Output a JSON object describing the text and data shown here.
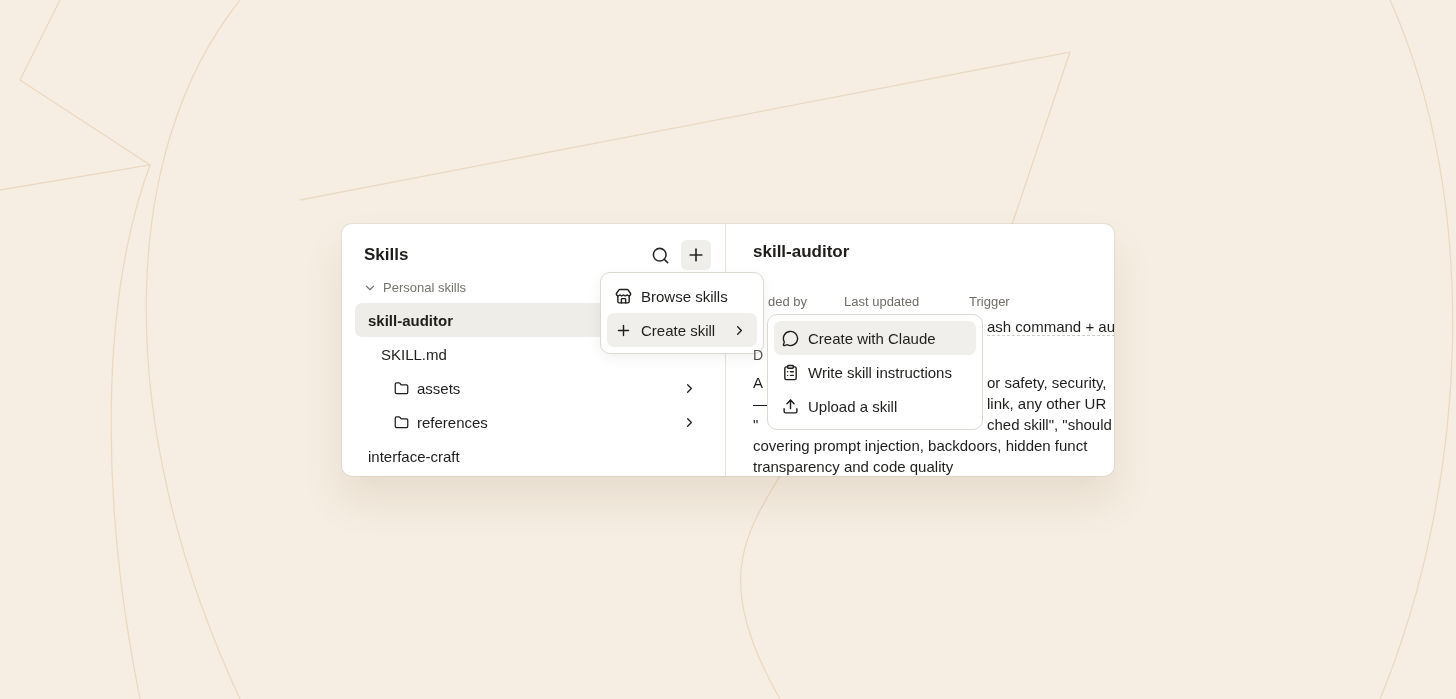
{
  "sidebar": {
    "title": "Skills",
    "add_active": true,
    "groups": [
      {
        "label": "Personal skills",
        "expanded": true,
        "items": [
          {
            "label": "skill-auditor",
            "selected": true,
            "children": [
              {
                "label": "SKILL.md",
                "kind": "file"
              },
              {
                "label": "assets",
                "kind": "folder"
              },
              {
                "label": "references",
                "kind": "folder"
              }
            ]
          },
          {
            "label": "interface-craft",
            "selected": false
          }
        ]
      }
    ]
  },
  "detail": {
    "title": "skill-auditor",
    "meta_labels": [
      "ded by",
      "Last updated",
      "Trigger"
    ],
    "meta_value": "ash command + au",
    "description_label": "D",
    "description_lines": [
      {
        "left": "A",
        "right": "or safety, security,"
      },
      {
        "left": "—",
        "right": "link, any other UR"
      },
      {
        "left": "\"",
        "right": "ched skill\", \"should"
      },
      {
        "left": "covering prompt injection, backdoors, hidden funct"
      },
      {
        "left": "transparency and code quality"
      }
    ]
  },
  "menu": {
    "items": [
      {
        "label": "Browse skills",
        "selected": false,
        "has_submenu": false
      },
      {
        "label": "Create skill",
        "selected": true,
        "has_submenu": true
      }
    ]
  },
  "submenu": {
    "items": [
      {
        "label": "Create with Claude",
        "selected": true
      },
      {
        "label": "Write skill instructions",
        "selected": false
      },
      {
        "label": "Upload a skill",
        "selected": false
      }
    ]
  }
}
